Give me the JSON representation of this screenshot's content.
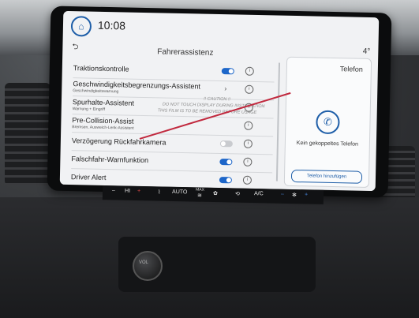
{
  "topbar": {
    "time": "10:08",
    "home_icon": "home-icon",
    "temperature": "4°",
    "back_icon": "back-arrow-icon"
  },
  "screen": {
    "title": "Fahrerassistenz"
  },
  "list": [
    {
      "label": "Traktionskontrolle",
      "sub": "",
      "control": "toggle-on"
    },
    {
      "label": "Geschwindigkeitsbegrenzungs-Assistent",
      "sub": "Geschwindigkeitswarnung",
      "control": "chevron"
    },
    {
      "label": "Spurhalte-Assistent",
      "sub": "Warnung + Eingriff",
      "control": "info"
    },
    {
      "label": "Pre-Collision-Assist",
      "sub": "Bremsen, Ausweich-Lenk-Assistent",
      "control": "info"
    },
    {
      "label": "Verzögerung Rückfahrkamera",
      "sub": "",
      "control": "toggle-off"
    },
    {
      "label": "Falschfahr-Warnfunktion",
      "sub": "",
      "control": "toggle-on"
    },
    {
      "label": "Driver Alert",
      "sub": "",
      "control": "toggle-on"
    }
  ],
  "caution": {
    "line1": "!! CAUTION !!",
    "line2": "DO NOT TOUCH DISPLAY DURING INSTALLATION",
    "line3": "THIS FILM IS TO BE REMOVED BEFORE USAGE"
  },
  "phone": {
    "title": "Telefon",
    "message": "Kein gekoppeltes Telefon",
    "add_button": "Telefon hinzufügen"
  },
  "climate": {
    "minus_left": "–",
    "hi_label": "HI",
    "plus_left": "+",
    "auto_label": "AUTO",
    "max_label": "MAX",
    "ac_label": "A/C",
    "minus_right": "–",
    "plus_right": "+"
  },
  "console": {
    "knob_label": "VOL"
  },
  "colors": {
    "accent": "#1e5ea8",
    "toggle_on": "#1d66c9",
    "toggle_off": "#c9cbcf",
    "annotation_line": "#c1293e"
  }
}
